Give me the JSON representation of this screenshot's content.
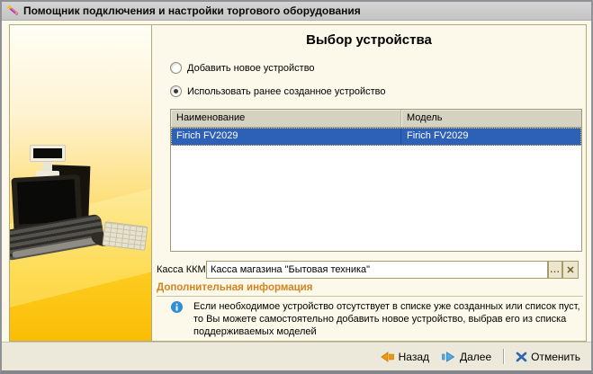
{
  "window": {
    "title": "Помощник подключения и настройки торгового оборудования"
  },
  "page": {
    "heading": "Выбор устройства",
    "options": {
      "add_new": "Добавить новое устройство",
      "use_existing": "Использовать ранее созданное устройство",
      "selected": "use_existing"
    },
    "device_table": {
      "columns": [
        "Наименование",
        "Модель"
      ],
      "rows": [
        {
          "name": "Firich FV2029",
          "model": "Firich FV2029",
          "selected": true
        }
      ]
    },
    "kkm_field": {
      "label": "Касса ККМ:",
      "value": "Касса магазина \"Бытовая техника\"",
      "browse_button": "...",
      "clear_button": "✕"
    },
    "additional_info": {
      "header": "Дополнительная информация",
      "text": "Если необходимое устройство отсутствует в списке уже созданных или список пуст, то Вы можете самостоятельно добавить новое устройство, выбрав его из списка поддерживаемых моделей"
    }
  },
  "footer": {
    "back_label": "Назад",
    "next_label": "Далее",
    "cancel_label": "Отменить"
  },
  "colors": {
    "selection_blue": "#2D61B8",
    "accent_orange": "#D4821E",
    "info_blue": "#2F8FD4",
    "back_icon_orange": "#F59A00",
    "next_icon_blue": "#53ACE8",
    "cancel_icon_blue": "#2B67B1",
    "panel_gradient_top": "#FFFEF6",
    "panel_gradient_bottom": "#FBBD05"
  }
}
